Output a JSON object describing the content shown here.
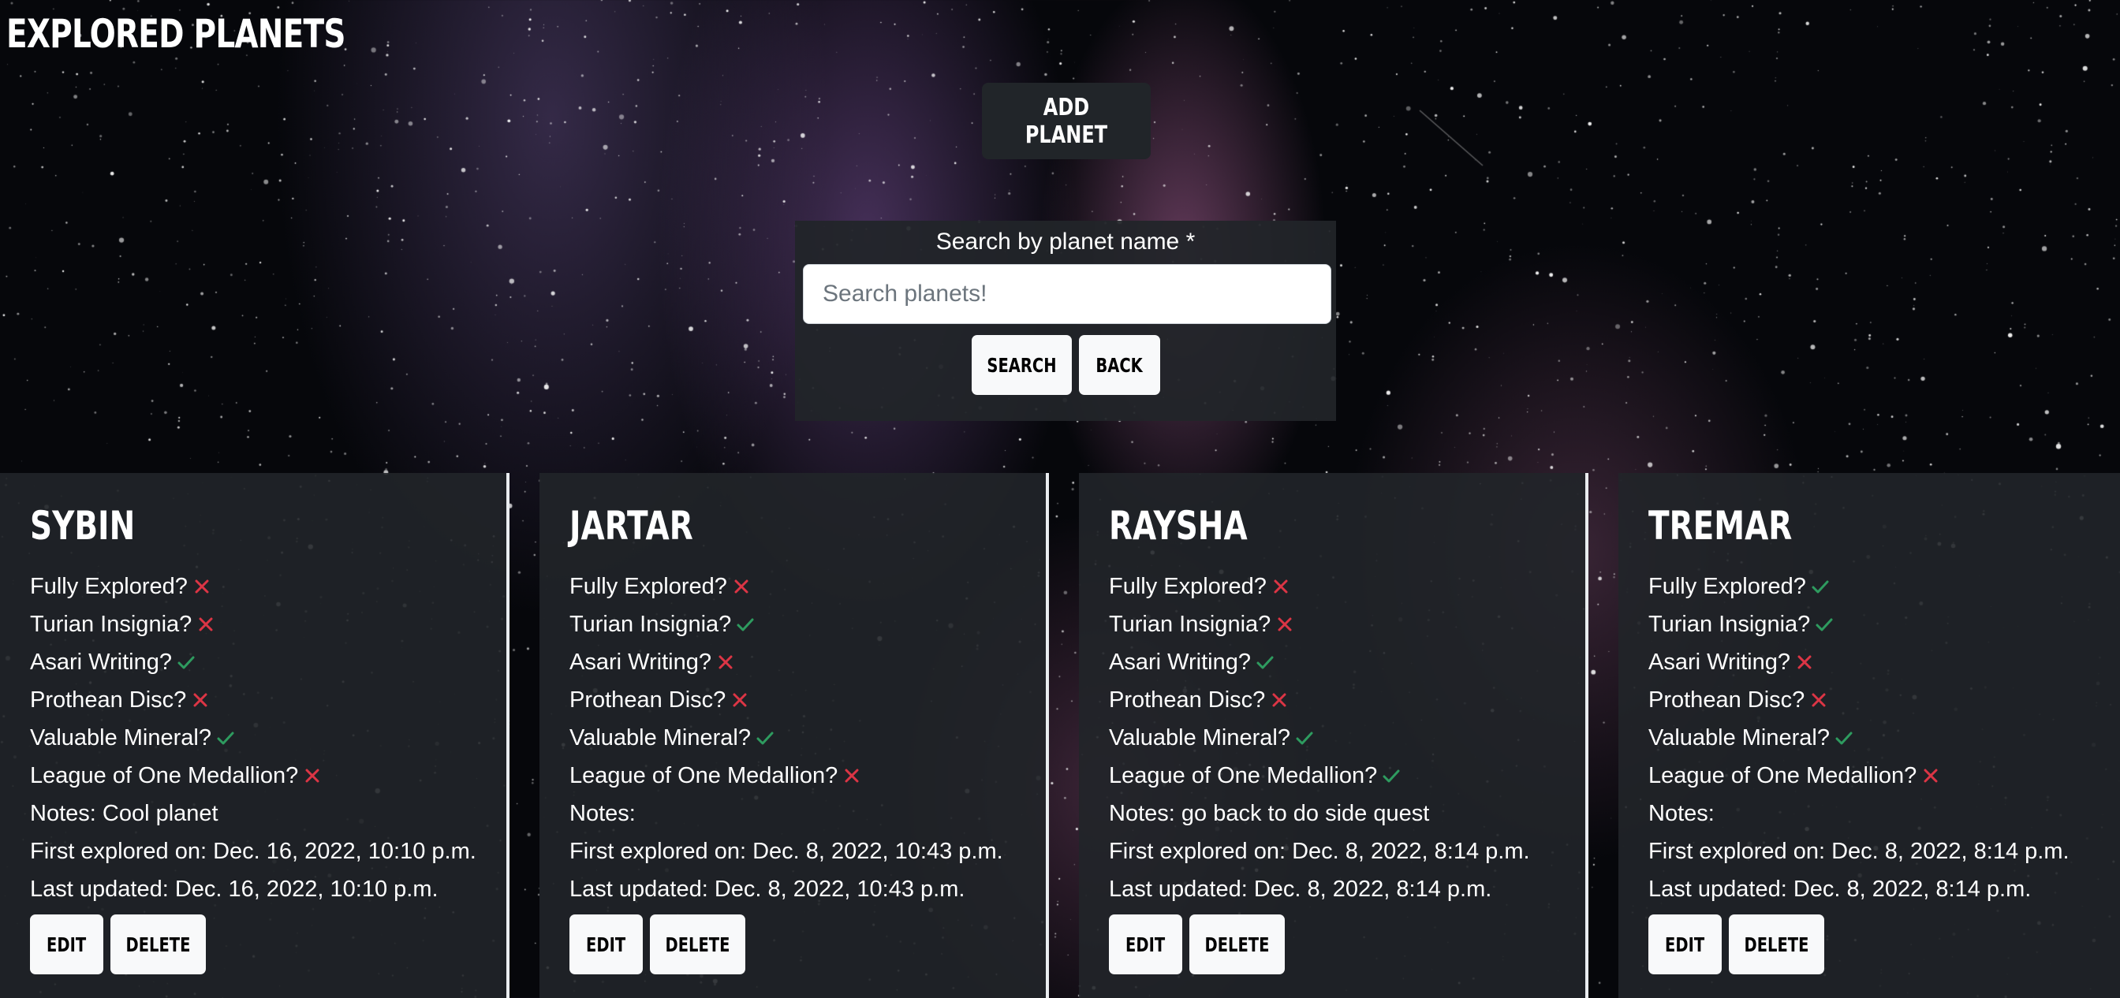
{
  "page": {
    "title": "EXPLORED PLANETS"
  },
  "toolbar": {
    "add_planet_label": "ADD PLANET"
  },
  "search": {
    "label": "Search by planet name *",
    "placeholder": "Search planets!",
    "value": "",
    "search_label": "SEARCH",
    "back_label": "BACK"
  },
  "colors": {
    "check": "#2e9b5f",
    "cross": "#dc3545"
  },
  "field_labels": {
    "fully_explored": "Fully Explored?",
    "turian_insignia": "Turian Insignia?",
    "asari_writing": "Asari Writing?",
    "prothean_disc": "Prothean Disc?",
    "valuable_mineral": "Valuable Mineral?",
    "league_medallion": "League of One Medallion?",
    "notes": "Notes:",
    "first_explored": "First explored on:",
    "last_updated": "Last updated:"
  },
  "planets": [
    {
      "name": "SYBIN",
      "fully_explored": false,
      "turian_insignia": false,
      "asari_writing": true,
      "prothean_disc": false,
      "valuable_mineral": true,
      "league_medallion": false,
      "notes": "Cool planet",
      "first_explored": "Dec. 16, 2022, 10:10 p.m.",
      "last_updated": "Dec. 16, 2022, 10:10 p.m.",
      "edit_label": "EDIT",
      "delete_label": "DELETE"
    },
    {
      "name": "JARTAR",
      "fully_explored": false,
      "turian_insignia": true,
      "asari_writing": false,
      "prothean_disc": false,
      "valuable_mineral": true,
      "league_medallion": false,
      "notes": "",
      "first_explored": "Dec. 8, 2022, 10:43 p.m.",
      "last_updated": "Dec. 8, 2022, 10:43 p.m.",
      "edit_label": "EDIT",
      "delete_label": "DELETE"
    },
    {
      "name": "RAYSHA",
      "fully_explored": false,
      "turian_insignia": false,
      "asari_writing": true,
      "prothean_disc": false,
      "valuable_mineral": true,
      "league_medallion": true,
      "notes": "go back to do side quest",
      "first_explored": "Dec. 8, 2022, 8:14 p.m.",
      "last_updated": "Dec. 8, 2022, 8:14 p.m.",
      "edit_label": "EDIT",
      "delete_label": "DELETE"
    },
    {
      "name": "TREMAR",
      "fully_explored": true,
      "turian_insignia": true,
      "asari_writing": false,
      "prothean_disc": false,
      "valuable_mineral": true,
      "league_medallion": false,
      "notes": "",
      "first_explored": "Dec. 8, 2022, 8:14 p.m.",
      "last_updated": "Dec. 8, 2022, 8:14 p.m.",
      "edit_label": "EDIT",
      "delete_label": "DELETE"
    }
  ]
}
